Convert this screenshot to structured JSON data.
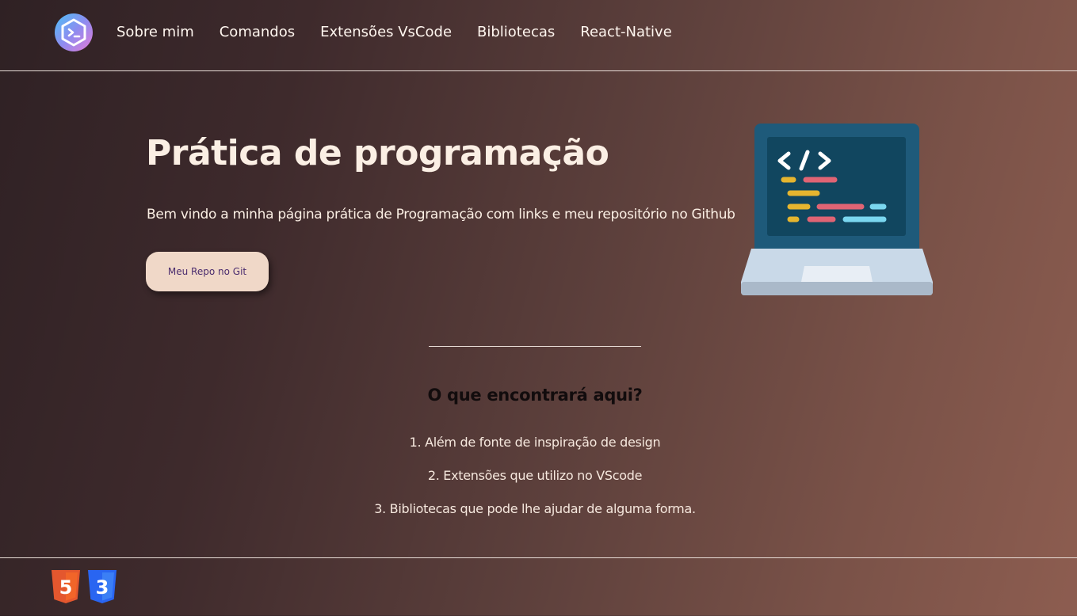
{
  "nav": {
    "logo_icon": "terminal-prompt-icon",
    "items": [
      {
        "label": "Sobre mim"
      },
      {
        "label": "Comandos"
      },
      {
        "label": "Extensões VsCode"
      },
      {
        "label": "Bibliotecas"
      },
      {
        "label": "React-Native"
      }
    ]
  },
  "hero": {
    "title": "Prática de programação",
    "subtitle": "Bem vindo a minha página prática de Programação com links e meu repositório no Github",
    "button_label": "Meu Repo no Git",
    "illustration_icon": "laptop-code-icon"
  },
  "section": {
    "title": "O que encontrará aqui?",
    "items": [
      "1. Além de fonte de inspiração de design",
      "2. Extensões que utilizo no VScode",
      "3. Bibliotecas que pode lhe ajudar de alguma forma."
    ]
  },
  "footer": {
    "badges": [
      {
        "icon": "html5-icon",
        "label": "5",
        "color": "#e4572e"
      },
      {
        "icon": "css3-icon",
        "label": "3",
        "color": "#2965f1"
      }
    ]
  },
  "colors": {
    "accent_button": "#f0d8c8",
    "button_text": "#4a2c6e",
    "heading_text": "#fbefe4",
    "section_title": "#120c0d"
  }
}
